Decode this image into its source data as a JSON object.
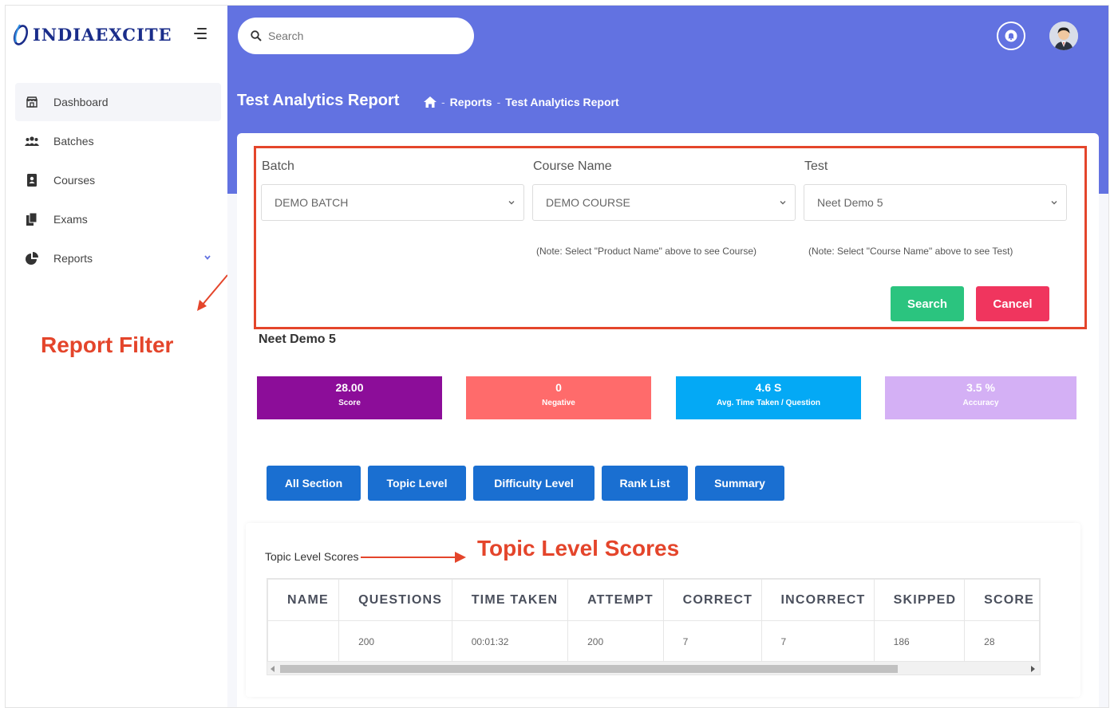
{
  "brand": {
    "name": "INDIAEXCITE"
  },
  "sidebar": {
    "items": [
      {
        "label": "Dashboard",
        "icon": "store-icon"
      },
      {
        "label": "Batches",
        "icon": "users-icon"
      },
      {
        "label": "Courses",
        "icon": "address-book-icon"
      },
      {
        "label": "Exams",
        "icon": "copy-icon"
      },
      {
        "label": "Reports",
        "icon": "pie-chart-icon"
      }
    ]
  },
  "header": {
    "search_placeholder": "Search",
    "page_title": "Test Analytics Report",
    "breadcrumb": [
      "Reports",
      "Test Analytics Report"
    ]
  },
  "filter": {
    "batch_label": "Batch",
    "batch_value": "DEMO BATCH",
    "course_label": "Course Name",
    "course_value": "DEMO COURSE",
    "course_note": "(Note: Select \"Product Name\" above to see Course)",
    "test_label": "Test",
    "test_value": "Neet Demo 5",
    "test_note": "(Note: Select \"Course Name\" above to see Test)",
    "search_label": "Search",
    "cancel_label": "Cancel"
  },
  "annotations": {
    "report_filter": "Report Filter",
    "topic_level_scores": "Topic Level Scores"
  },
  "test_name": "Neet Demo 5",
  "stats": [
    {
      "value": "28.00",
      "label": "Score",
      "color": "#8c0d99"
    },
    {
      "value": "0",
      "label": "Negative",
      "color": "#ff6b6b"
    },
    {
      "value": "4.6 S",
      "label": "Avg. Time Taken / Question",
      "color": "#04a9f5"
    },
    {
      "value": "3.5 %",
      "label": "Accuracy",
      "color": "#d4b0f5"
    }
  ],
  "tabs": [
    "All Section",
    "Topic Level",
    "Difficulty Level",
    "Rank List",
    "Summary"
  ],
  "scores": {
    "title": "Topic Level Scores",
    "columns": [
      "NAME",
      "QUESTIONS",
      "TIME TAKEN",
      "ATTEMPT",
      "CORRECT",
      "INCORRECT",
      "SKIPPED",
      "SCORE"
    ],
    "rows": [
      [
        "",
        "200",
        "00:01:32",
        "200",
        "7",
        "7",
        "186",
        "28"
      ]
    ]
  }
}
